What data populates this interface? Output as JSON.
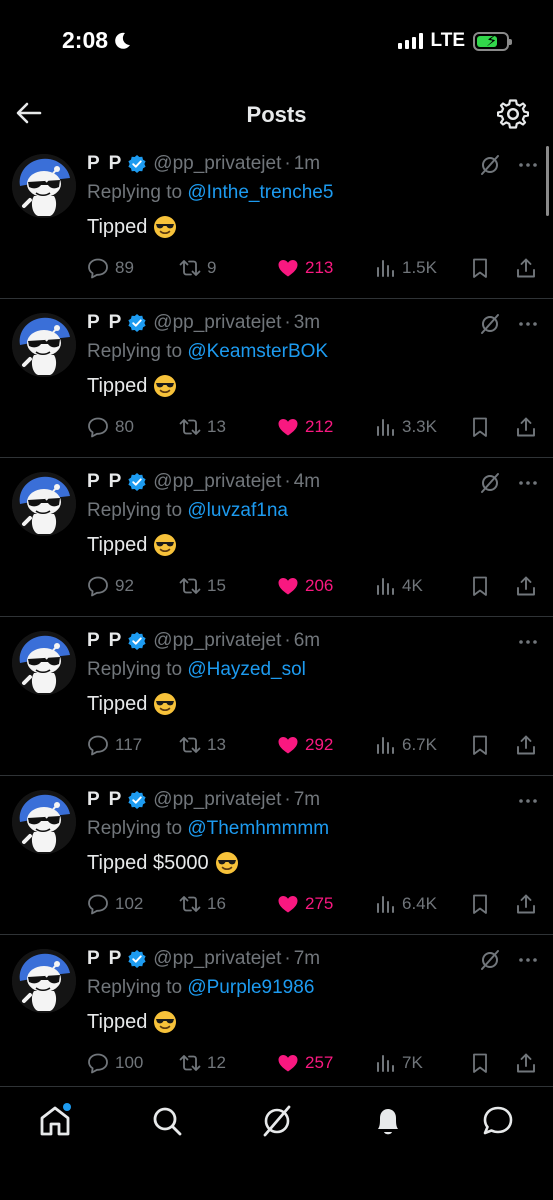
{
  "status": {
    "time": "2:08",
    "network": "LTE"
  },
  "header": {
    "title": "Posts"
  },
  "posts": [
    {
      "name": "P P",
      "handle": "@pp_privatejet",
      "sep": "·",
      "time": "1m",
      "reply_prefix": "Replying to ",
      "reply_to": "@Inthe_trenche5",
      "text": "Tipped",
      "emoji": "😎",
      "replies": "89",
      "reposts": "9",
      "likes": "213",
      "views": "1.5K",
      "show_grok": true
    },
    {
      "name": "P P",
      "handle": "@pp_privatejet",
      "sep": "·",
      "time": "3m",
      "reply_prefix": "Replying to ",
      "reply_to": "@KeamsterBOK",
      "text": "Tipped",
      "emoji": "😎",
      "replies": "80",
      "reposts": "13",
      "likes": "212",
      "views": "3.3K",
      "show_grok": true
    },
    {
      "name": "P P",
      "handle": "@pp_privatejet",
      "sep": "·",
      "time": "4m",
      "reply_prefix": "Replying to ",
      "reply_to": "@luvzaf1na",
      "text": "Tipped",
      "emoji": "😎",
      "replies": "92",
      "reposts": "15",
      "likes": "206",
      "views": "4K",
      "show_grok": true
    },
    {
      "name": "P P",
      "handle": "@pp_privatejet",
      "sep": "·",
      "time": "6m",
      "reply_prefix": "Replying to ",
      "reply_to": "@Hayzed_sol",
      "text": "Tipped",
      "emoji": "😎",
      "replies": "117",
      "reposts": "13",
      "likes": "292",
      "views": "6.7K",
      "show_grok": false
    },
    {
      "name": "P P",
      "handle": "@pp_privatejet",
      "sep": "·",
      "time": "7m",
      "reply_prefix": "Replying to ",
      "reply_to": "@Themhmmmm",
      "text": "Tipped $5000",
      "emoji": "😎",
      "replies": "102",
      "reposts": "16",
      "likes": "275",
      "views": "6.4K",
      "show_grok": false
    },
    {
      "name": "P P",
      "handle": "@pp_privatejet",
      "sep": "·",
      "time": "7m",
      "reply_prefix": "Replying to ",
      "reply_to": "@Purple91986",
      "text": "Tipped",
      "emoji": "😎",
      "replies": "100",
      "reposts": "12",
      "likes": "257",
      "views": "7K",
      "show_grok": true
    }
  ],
  "icons": {
    "status": [
      "moon-icon",
      "signal-icon",
      "battery-charging-icon"
    ],
    "header": [
      "back-arrow-icon",
      "gear-icon"
    ],
    "post": [
      "verified-badge-icon",
      "grok-icon",
      "more-icon",
      "reply-icon",
      "repost-icon",
      "heart-icon",
      "views-icon",
      "bookmark-icon",
      "share-icon"
    ],
    "tabs": [
      "home-icon",
      "search-icon",
      "grok-icon",
      "notifications-icon",
      "messages-icon"
    ]
  },
  "colors": {
    "background": "#000000",
    "text": "#e7e9ea",
    "muted": "#71767b",
    "link": "#1d9bf0",
    "like": "#f91880",
    "divider": "#2f3336"
  }
}
